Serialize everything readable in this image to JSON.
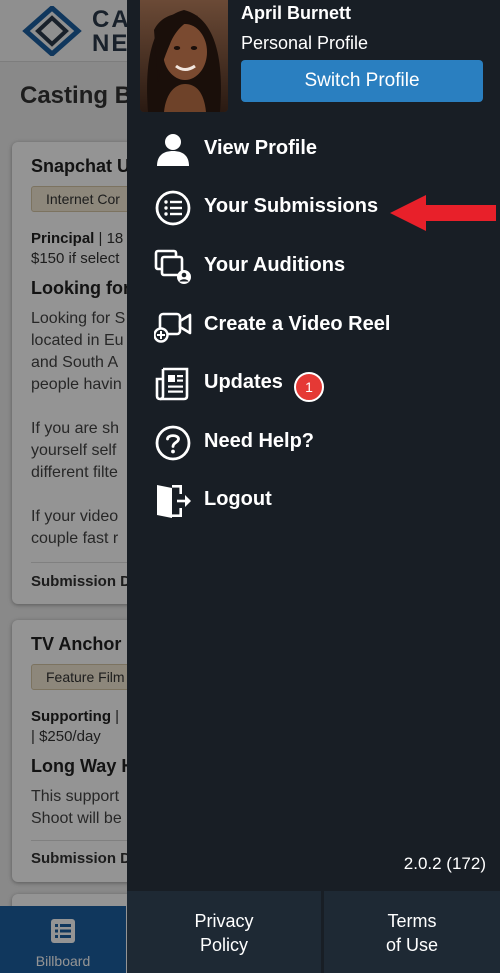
{
  "background": {
    "logo_text": "CA\nNE",
    "page_title": "Casting B",
    "cards": [
      {
        "title": "Snapchat U",
        "tag": "Internet Cor",
        "role": "Principal",
        "role_rest": " | 18",
        "pay": "$150 if select",
        "subheading": "Looking for",
        "body_lines": [
          "Looking for S",
          "located in Eu",
          "and South A",
          "people havin",
          "",
          "If you are sh",
          "yourself self",
          "different filte",
          "",
          "If your video",
          "couple fast r"
        ],
        "footer": "Submission D"
      },
      {
        "title": "TV Anchor -",
        "tag": "Feature Film",
        "role": "Supporting",
        "role_rest": " |",
        "pay": "| $250/day",
        "subheading": "Long Way H",
        "body_lines": [
          "This support",
          "Shoot will be"
        ],
        "footer": "Submission D"
      }
    ],
    "bottom_nav": {
      "billboard_label": "Billboard"
    }
  },
  "drawer": {
    "user_name": "April Burnett",
    "profile_type": "Personal Profile",
    "switch_button": "Switch Profile",
    "menu": [
      {
        "label": "View Profile",
        "icon": "person-icon"
      },
      {
        "label": "Your Submissions",
        "icon": "list-icon"
      },
      {
        "label": "Your Auditions",
        "icon": "auditions-icon"
      },
      {
        "label": "Create a Video Reel",
        "icon": "video-add-icon"
      },
      {
        "label": "Updates",
        "icon": "newspaper-icon",
        "badge": "1"
      },
      {
        "label": "Need Help?",
        "icon": "help-icon"
      },
      {
        "label": "Logout",
        "icon": "logout-icon"
      }
    ],
    "version": "2.0.2 (172)",
    "footer": {
      "privacy_line1": "Privacy",
      "privacy_line2": "Policy",
      "terms_line1": "Terms",
      "terms_line2": "of Use"
    }
  },
  "colors": {
    "drawer_bg": "#181e25",
    "accent_blue": "#2a7fc0",
    "badge_red": "#e53935",
    "annotation_arrow": "#e8202a"
  }
}
